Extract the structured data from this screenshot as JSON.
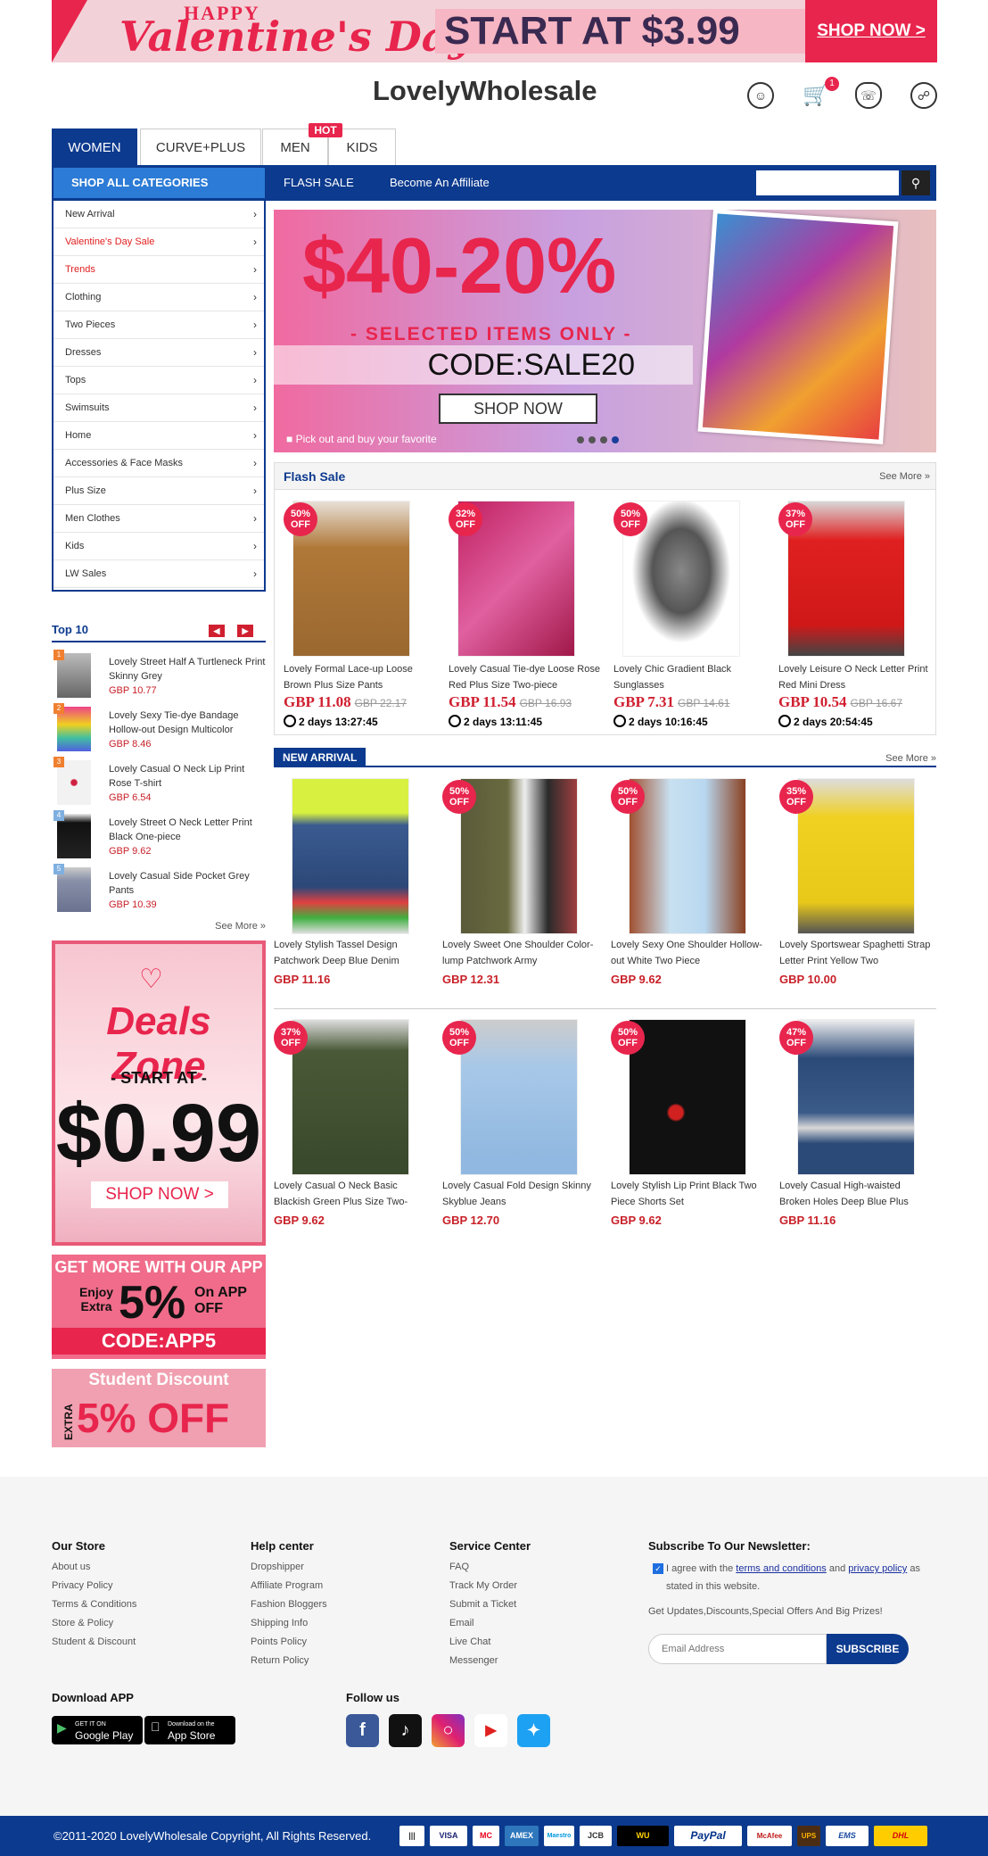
{
  "promo": {
    "happy": "HAPPY",
    "valentines": "Valentine's Day",
    "start_at": "START AT $3.99",
    "shop_now": "SHOP NOW >"
  },
  "header": {
    "logo": "LovelyWholesale",
    "cart_count": "1"
  },
  "tabs": [
    "WOMEN",
    "CURVE+PLUS",
    "MEN",
    "KIDS"
  ],
  "hot_badge": "HOT",
  "nav": {
    "shop_all": "SHOP ALL CATEGORIES",
    "flash_sale": "FLASH SALE",
    "affiliate": "Become An Affiliate"
  },
  "categories": [
    "New Arrival",
    "Valentine's Day Sale",
    "Trends",
    "Clothing",
    "Two Pieces",
    "Dresses",
    "Tops",
    "Swimsuits",
    "Home",
    "Accessories & Face Masks",
    "Plus Size",
    "Men Clothes",
    "Kids",
    "LW Sales"
  ],
  "banner": {
    "big": "$40-20%",
    "selected": "- SELECTED ITEMS ONLY -",
    "code": "CODE:SALE20",
    "shop": "SHOP NOW",
    "caption": "Pick out and buy your favorite"
  },
  "flash": {
    "title": "Flash Sale",
    "see_more": "See More »",
    "items": [
      {
        "off": "50%",
        "name": "Lovely Formal Lace-up Loose Brown Plus Size Pants",
        "price": "GBP 11.08",
        "old": "GBP 22.17",
        "timer": "2 days 13:27:45"
      },
      {
        "off": "32%",
        "name": "Lovely Casual Tie-dye Loose Rose Red Plus Size Two-piece",
        "price": "GBP 11.54",
        "old": "GBP 16.93",
        "timer": "2 days 13:11:45"
      },
      {
        "off": "50%",
        "name": "Lovely Chic Gradient Black Sunglasses",
        "price": "GBP 7.31",
        "old": "GBP 14.61",
        "timer": "2 days 10:16:45"
      },
      {
        "off": "37%",
        "name": "Lovely Leisure O Neck Letter Print Red Mini Dress",
        "price": "GBP 10.54",
        "old": "GBP 16.67",
        "timer": "2 days 20:54:45"
      }
    ]
  },
  "new_arrival": {
    "title": "NEW ARRIVAL",
    "see_more": "See More »",
    "items": [
      {
        "off": "",
        "name": "Lovely Stylish Tassel Design Patchwork Deep Blue Denim",
        "price": "GBP 11.16"
      },
      {
        "off": "50%",
        "name": "Lovely Sweet One Shoulder Color-lump Patchwork Army",
        "price": "GBP 12.31"
      },
      {
        "off": "50%",
        "name": "Lovely Sexy One Shoulder Hollow-out White Two Piece",
        "price": "GBP 9.62"
      },
      {
        "off": "35%",
        "name": "Lovely Sportswear Spaghetti Strap Letter Print Yellow Two",
        "price": "GBP 10.00"
      },
      {
        "off": "37%",
        "name": "Lovely Casual O Neck Basic Blackish Green Plus Size Two-",
        "price": "GBP 9.62"
      },
      {
        "off": "50%",
        "name": "Lovely Casual Fold Design Skinny Skyblue Jeans",
        "price": "GBP 12.70"
      },
      {
        "off": "50%",
        "name": "Lovely Stylish Lip Print Black Two Piece Shorts Set",
        "price": "GBP 9.62"
      },
      {
        "off": "47%",
        "name": "Lovely Casual High-waisted Broken Holes Deep Blue Plus",
        "price": "GBP 11.16"
      }
    ]
  },
  "off_label": "OFF",
  "top10": {
    "title": "Top 10",
    "see_more": "See More »",
    "items": [
      {
        "name": "Lovely Street Half A Turtleneck Print Skinny Grey",
        "price": "GBP 10.77"
      },
      {
        "name": "Lovely Sexy Tie-dye Bandage Hollow-out Design Multicolor",
        "price": "GBP 8.46"
      },
      {
        "name": "Lovely Casual O Neck Lip Print Rose T-shirt",
        "price": "GBP 6.54"
      },
      {
        "name": "Lovely Street O Neck Letter Print Black One-piece",
        "price": "GBP 9.62"
      },
      {
        "name": "Lovely Casual Side Pocket Grey Pants",
        "price": "GBP 10.39"
      }
    ]
  },
  "deals": {
    "title": "Deals Zone",
    "start": "- START AT -",
    "price": "$0.99",
    "shop": "SHOP NOW >"
  },
  "app_promo": {
    "l1": "GET MORE WITH OUR APP",
    "l2": "Enjoy Extra",
    "l3": "5%",
    "l3b": "On APP OFF",
    "code": "CODE:APP5"
  },
  "student": {
    "title": "Student Discount",
    "extra": "EXTRA",
    "off": "5% OFF"
  },
  "footer": {
    "our_store": {
      "title": "Our Store",
      "items": [
        "About us",
        "Privacy Policy",
        "Terms & Conditions",
        "Store & Policy",
        "Student & Discount"
      ]
    },
    "help": {
      "title": "Help center",
      "items": [
        "Dropshipper",
        "Affiliate Program",
        "Fashion Bloggers",
        "Shipping Info",
        "Points Policy",
        "Return Policy"
      ]
    },
    "service": {
      "title": "Service Center",
      "items": [
        "FAQ",
        "Track My Order",
        "Submit a Ticket",
        "Email",
        "Live Chat",
        "Messenger"
      ]
    },
    "newsletter": {
      "title": "Subscribe To Our Newsletter:",
      "agree_pre": "I agree with the",
      "terms": "terms and conditions",
      "and": "and",
      "privacy": "privacy policy",
      "agree_post": "as stated in this website.",
      "updates": "Get Updates,Discounts,Special Offers And Big Prizes!",
      "placeholder": "Email Address",
      "button": "SUBSCRIBE"
    },
    "download": {
      "title": "Download APP",
      "google_small": "GET IT ON",
      "google": "Google Play",
      "apple_small": "Download on the",
      "apple": "App Store"
    },
    "follow": "Follow us",
    "copyright": "©2011-2020 LovelyWholesale Copyright, All Rights Reserved.",
    "payments": [
      "VISA",
      "MC",
      "AMEX",
      "Maestro",
      "JCB",
      "WU",
      "PayPal",
      "McAfee",
      "UPS",
      "EMS",
      "DHL"
    ]
  }
}
